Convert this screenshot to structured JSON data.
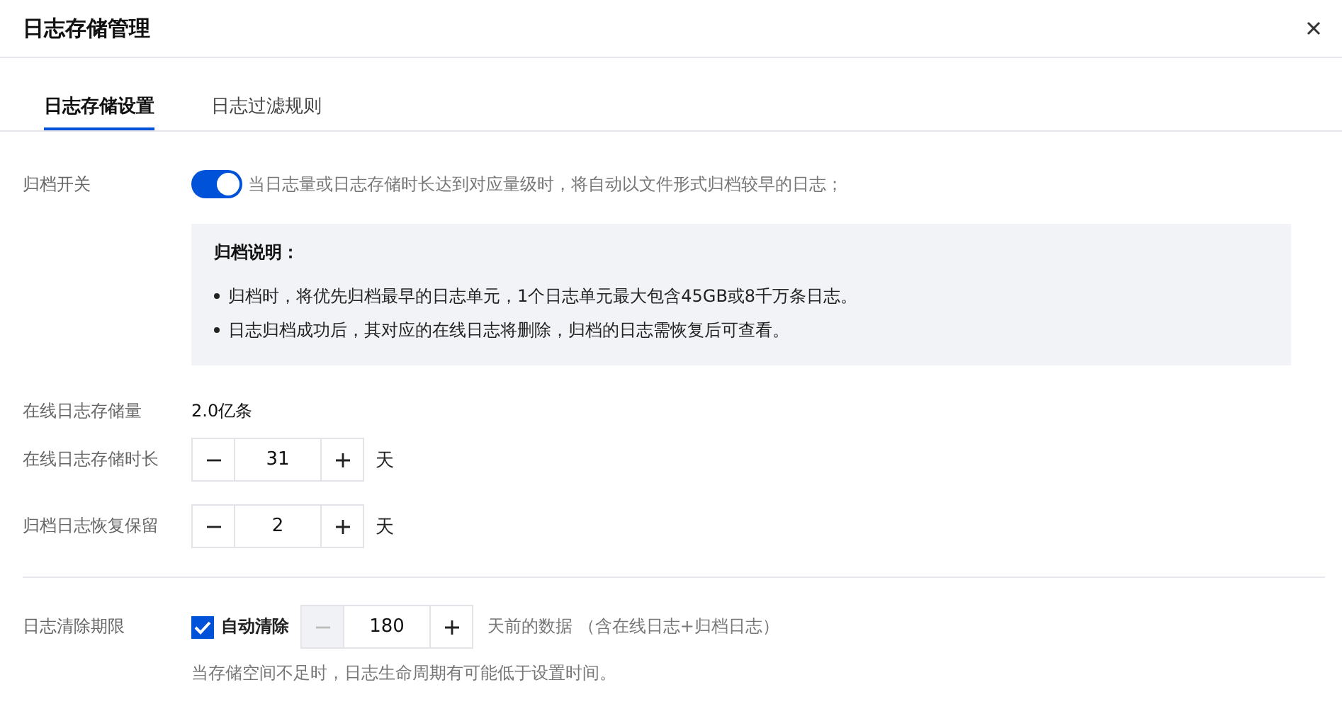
{
  "window": {
    "title": "日志存储管理"
  },
  "tabs": [
    {
      "label": "日志存储设置",
      "selected": true
    },
    {
      "label": "日志过滤规则",
      "selected": false
    }
  ],
  "archive_switch": {
    "label": "归档开关",
    "on": true,
    "description": "当日志量或日志存储时长达到对应量级时，将自动以文件形式归档较早的日志；"
  },
  "archive_note": {
    "title": "归档说明：",
    "items": [
      "归档时，将优先归档最早的日志单元，1个日志单元最大包含45GB或8千万条日志。",
      "日志归档成功后，其对应的在线日志将删除，归档的日志需恢复后可查看。"
    ]
  },
  "storage_amount": {
    "label": "在线日志存储量",
    "value": "2.0亿条"
  },
  "steppers": [
    {
      "label": "在线日志存储时长",
      "value": "31",
      "unit": "天",
      "minus_disabled": false
    },
    {
      "label": "归档日志恢复保留",
      "value": "2",
      "unit": "天",
      "minus_disabled": false
    }
  ],
  "cleanup": {
    "label": "日志清除期限",
    "checkbox": {
      "label": "自动清除",
      "checked": true
    },
    "stepper": {
      "value": "180",
      "minus_disabled": true
    },
    "suffix": "天前的数据 （含在线日志+归档日志）",
    "hint": "当存储空间不足时，日志生命周期有可能低于设置时间。"
  }
}
